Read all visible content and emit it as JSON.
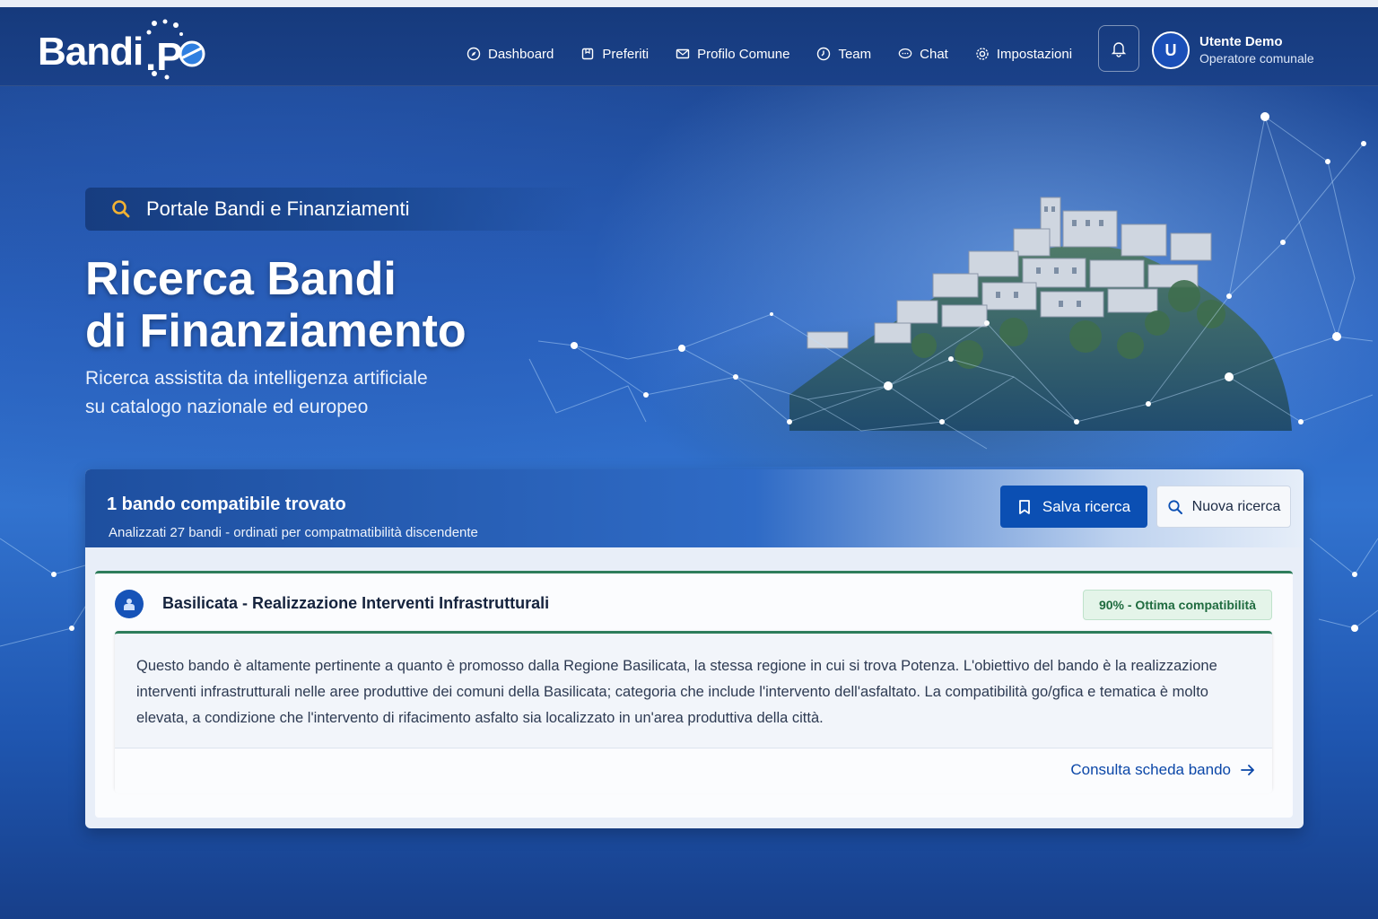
{
  "brand": {
    "logo_text": "Bandi.PA",
    "logo_main": "Bandi",
    "logo_suffix": ".PA"
  },
  "nav": [
    {
      "label": "Dashboard",
      "icon": "compass-icon"
    },
    {
      "label": "Preferiti",
      "icon": "bookmark-icon"
    },
    {
      "label": "Profilo Comune",
      "icon": "mail-icon"
    },
    {
      "label": "Team",
      "icon": "clock-icon"
    },
    {
      "label": "Chat",
      "icon": "chat-icon"
    },
    {
      "label": "Impostazioni",
      "icon": "gear-icon"
    }
  ],
  "user": {
    "initial": "U",
    "name": "Utente Demo",
    "role": "Operatore comunale"
  },
  "hero": {
    "pill": "Portale Bandi e Finanziamenti",
    "title_line1": "Ricerca Bandi",
    "title_line2": "di Finanziamento",
    "subtitle_line1": "Ricerca assistita da intelligenza artificiale",
    "subtitle_line2": "su catalogo nazionale ed europeo"
  },
  "results": {
    "count": "1 bando compatibile trovato",
    "analyzed": "Analizzati 27 bandi - ordinati per compatmatibilità discendente",
    "save_label": "Salva ricerca",
    "new_label": "Nuova ricerca"
  },
  "card": {
    "title": "Basilicata - Realizzazione Interventi Infrastrutturali",
    "badge": "90% - Ottima compatibilità",
    "compatibility_percent": 90,
    "description": "Questo bando è altamente pertinente a quanto è promosso dalla Regione Basilicata, la stessa regione in cui si trova Potenza. L'obiettivo del bando è la realizzazione interventi infrastrutturali nelle aree produttive dei comuni della Basilicata; categoria che include l'intervento dell'asfaltato. La compatibilità go/gfica e tematica è molto elevata, a condizione che l'intervento di rifacimento asfalto sia localizzato in un'area produttiva della città.",
    "link": "Consulta scheda bando"
  },
  "colors": {
    "primary": "#0b4fb3",
    "success": "#2e7d5b",
    "header": "#163a7c"
  }
}
